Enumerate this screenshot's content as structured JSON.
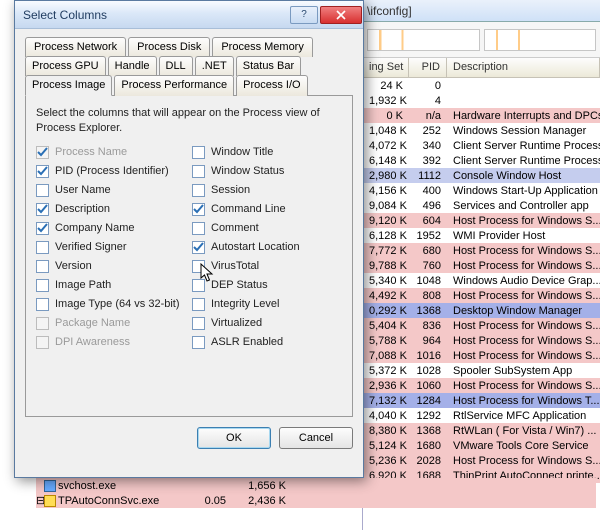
{
  "dialog": {
    "title": "Select Columns",
    "help_symbol": "?",
    "description": "Select the columns that will appear on the Process view of Process Explorer.",
    "tab_rows": [
      [
        "Process Network",
        "Process Disk",
        "Process Memory"
      ],
      [
        "Process GPU",
        "Handle",
        "DLL",
        ".NET",
        "Status Bar"
      ],
      [
        "Process Image",
        "Process Performance",
        "Process I/O"
      ]
    ],
    "active_tab": "Process Image",
    "left_checks": [
      {
        "label": "Process Name",
        "checked": true,
        "disabled": true
      },
      {
        "label": "PID (Process Identifier)",
        "checked": true,
        "disabled": false
      },
      {
        "label": "User Name",
        "checked": false,
        "disabled": false
      },
      {
        "label": "Description",
        "checked": true,
        "disabled": false
      },
      {
        "label": "Company Name",
        "checked": true,
        "disabled": false
      },
      {
        "label": "Verified Signer",
        "checked": false,
        "disabled": false
      },
      {
        "label": "Version",
        "checked": false,
        "disabled": false
      },
      {
        "label": "Image Path",
        "checked": false,
        "disabled": false
      },
      {
        "label": "Image Type (64 vs 32-bit)",
        "checked": false,
        "disabled": false
      },
      {
        "label": "Package Name",
        "checked": false,
        "disabled": true
      },
      {
        "label": "DPI Awareness",
        "checked": false,
        "disabled": true
      }
    ],
    "right_checks": [
      {
        "label": "Window Title",
        "checked": false
      },
      {
        "label": "Window Status",
        "checked": false
      },
      {
        "label": "Session",
        "checked": false
      },
      {
        "label": "Command Line",
        "checked": true
      },
      {
        "label": "Comment",
        "checked": false
      },
      {
        "label": "Autostart Location",
        "checked": true
      },
      {
        "label": "VirusTotal",
        "checked": false
      },
      {
        "label": "DEP Status",
        "checked": false
      },
      {
        "label": "Integrity Level",
        "checked": false
      },
      {
        "label": "Virtualized",
        "checked": false
      },
      {
        "label": "ASLR Enabled",
        "checked": false
      }
    ],
    "ok": "OK",
    "cancel": "Cancel"
  },
  "bg": {
    "title_fragment": "\\ifconfig]",
    "headers": {
      "h1": "ing Set",
      "h2": "PID",
      "h3": "Description"
    },
    "rows": [
      {
        "ws": "24 K",
        "pid": "0",
        "desc": "",
        "cls": "r-plain"
      },
      {
        "ws": "1,932 K",
        "pid": "4",
        "desc": "",
        "cls": "r-plain"
      },
      {
        "ws": "0 K",
        "pid": "n/a",
        "desc": "Hardware Interrupts and DPCs",
        "cls": "r-pink"
      },
      {
        "ws": "1,048 K",
        "pid": "252",
        "desc": "Windows Session Manager",
        "cls": "r-plain"
      },
      {
        "ws": "4,072 K",
        "pid": "340",
        "desc": "Client Server Runtime Process",
        "cls": "r-plain"
      },
      {
        "ws": "6,148 K",
        "pid": "392",
        "desc": "Client Server Runtime Process",
        "cls": "r-plain"
      },
      {
        "ws": "2,980 K",
        "pid": "1112",
        "desc": "Console Window Host",
        "cls": "r-blue"
      },
      {
        "ws": "4,156 K",
        "pid": "400",
        "desc": "Windows Start-Up Application",
        "cls": "r-plain"
      },
      {
        "ws": "9,084 K",
        "pid": "496",
        "desc": "Services and Controller app",
        "cls": "r-plain"
      },
      {
        "ws": "9,120 K",
        "pid": "604",
        "desc": "Host Process for Windows S...",
        "cls": "r-pink"
      },
      {
        "ws": "6,128 K",
        "pid": "1952",
        "desc": "WMI Provider Host",
        "cls": "r-plain"
      },
      {
        "ws": "7,772 K",
        "pid": "680",
        "desc": "Host Process for Windows S...",
        "cls": "r-pink"
      },
      {
        "ws": "9,788 K",
        "pid": "760",
        "desc": "Host Process for Windows S...",
        "cls": "r-pink"
      },
      {
        "ws": "5,340 K",
        "pid": "1048",
        "desc": "Windows Audio Device Grap...",
        "cls": "r-plain"
      },
      {
        "ws": "4,492 K",
        "pid": "808",
        "desc": "Host Process for Windows S...",
        "cls": "r-pink"
      },
      {
        "ws": "0,292 K",
        "pid": "1368",
        "desc": "Desktop Window Manager",
        "cls": "r-dkblue"
      },
      {
        "ws": "5,404 K",
        "pid": "836",
        "desc": "Host Process for Windows S...",
        "cls": "r-pink"
      },
      {
        "ws": "5,788 K",
        "pid": "964",
        "desc": "Host Process for Windows S...",
        "cls": "r-pink"
      },
      {
        "ws": "7,088 K",
        "pid": "1016",
        "desc": "Host Process for Windows S...",
        "cls": "r-pink"
      },
      {
        "ws": "5,372 K",
        "pid": "1028",
        "desc": "Spooler SubSystem App",
        "cls": "r-plain"
      },
      {
        "ws": "2,936 K",
        "pid": "1060",
        "desc": "Host Process for Windows S...",
        "cls": "r-pink"
      },
      {
        "ws": "7,132 K",
        "pid": "1284",
        "desc": "Host Process for Windows T...",
        "cls": "r-dkblue"
      },
      {
        "ws": "4,040 K",
        "pid": "1292",
        "desc": "RtlService MFC Application",
        "cls": "r-plain"
      },
      {
        "ws": "8,380 K",
        "pid": "1368",
        "desc": "RtWLan ( For Vista / Win7) ...",
        "cls": "r-pink"
      },
      {
        "ws": "5,124 K",
        "pid": "1680",
        "desc": "VMware Tools Core Service",
        "cls": "r-pink"
      },
      {
        "ws": "5,236 K",
        "pid": "2028",
        "desc": "Host Process for Windows S...",
        "cls": "r-pink"
      },
      {
        "ws": "6,920 K",
        "pid": "1688",
        "desc": "ThinPrint AutoConnect printe...",
        "cls": "r-pink"
      }
    ]
  },
  "bottom": [
    {
      "name": "svchost.exe",
      "cpu": "",
      "ws": "1,656 K",
      "cls": ""
    },
    {
      "name": "TPAutoConnSvc.exe",
      "cpu": "0.05",
      "ws": "2,436 K",
      "cls": ""
    }
  ]
}
